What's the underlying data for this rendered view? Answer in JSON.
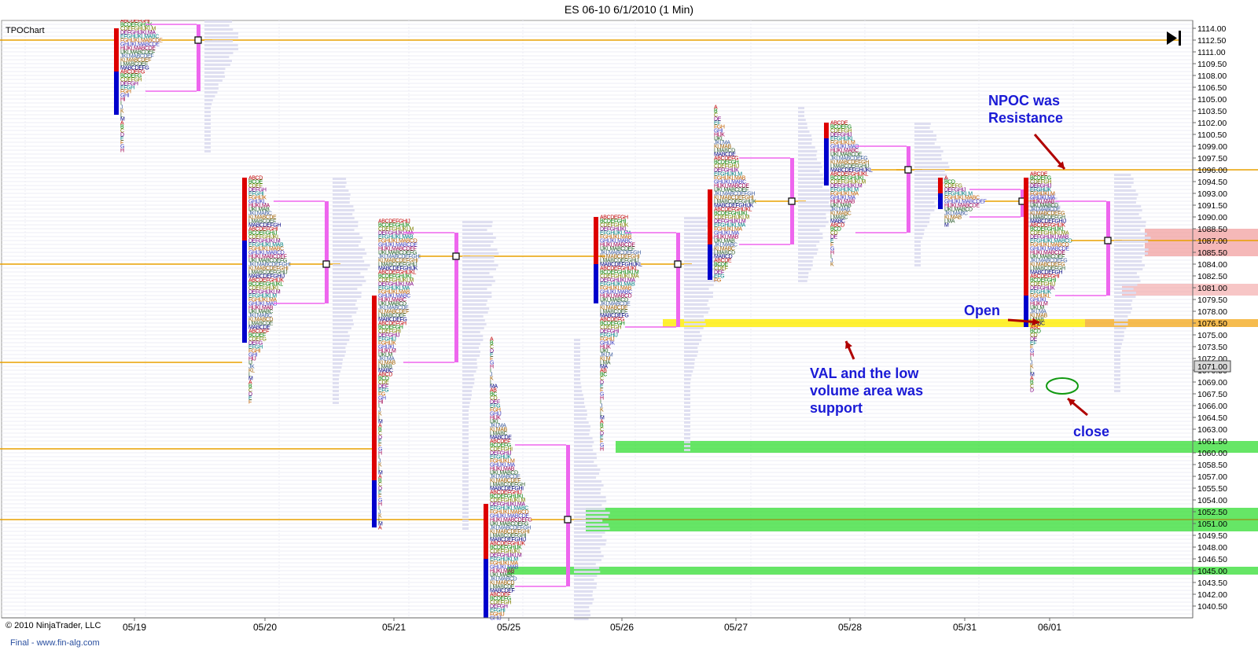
{
  "window": {
    "title": "ES 06-10  6/1/2010 (1 Min)",
    "chart_label": "TPOChart",
    "copyright": "© 2010 NinjaTrader, LLC",
    "watermark": "Final - www.fin-alg.com"
  },
  "colors": {
    "poc_line": "#e8a000",
    "value_area": "#ee66ee",
    "ib_red": "#dd0000",
    "ib_blue": "#0000cc",
    "profile_fill": "#dcdcf0",
    "annotation_text": "#1a1ad6",
    "annotation_arrow": "#b00000",
    "support_green": "#33dd33",
    "val_yellow": "#ffee00",
    "resistance_red": "#f2a0a0",
    "last_price_box": "#d8d8d8"
  },
  "chart_data": {
    "type": "market-profile",
    "title": "ES 06-10  6/1/2010 (1 Min)",
    "ylim": [
      1039.0,
      1115.0
    ],
    "y_ticks": [
      1114.0,
      1112.5,
      1111.0,
      1109.5,
      1108.0,
      1106.5,
      1105.0,
      1103.5,
      1102.0,
      1100.5,
      1099.0,
      1097.5,
      1096.0,
      1094.5,
      1093.0,
      1091.5,
      1090.0,
      1088.5,
      1087.0,
      1085.5,
      1084.0,
      1082.5,
      1081.0,
      1079.5,
      1078.0,
      1076.5,
      1075.0,
      1073.5,
      1072.0,
      1070.5,
      1069.0,
      1067.5,
      1066.0,
      1064.5,
      1063.0,
      1061.5,
      1060.0,
      1058.5,
      1057.0,
      1055.5,
      1054.0,
      1052.5,
      1051.0,
      1049.5,
      1048.0,
      1046.5,
      1045.0,
      1043.5,
      1042.0,
      1040.5
    ],
    "last_price": "1071.00",
    "sessions": [
      {
        "date": "05/19",
        "low": 1098.5,
        "high": 1115.0,
        "poc": 1112.5,
        "vah": 1114.5,
        "val": 1106.0,
        "ib_low": 1103.0,
        "ib_high": 1114.0,
        "ib_split": 1108.5
      },
      {
        "date": "05/20",
        "low": 1066.5,
        "high": 1095.0,
        "poc": 1084.0,
        "vah": 1092.0,
        "val": 1079.0,
        "ib_low": 1074.0,
        "ib_high": 1095.0,
        "ib_split": 1087.0
      },
      {
        "date": "05/21",
        "low": 1050.5,
        "high": 1089.5,
        "poc": 1085.0,
        "vah": 1088.0,
        "val": 1071.5,
        "ib_low": 1050.5,
        "ib_high": 1080.0,
        "ib_split": 1056.5
      },
      {
        "date": "05/25",
        "low": 1039.0,
        "high": 1074.5,
        "poc": 1051.5,
        "vah": 1061.0,
        "val": 1043.0,
        "ib_low": 1039.0,
        "ib_high": 1053.5,
        "ib_split": 1046.5
      },
      {
        "date": "05/26",
        "low": 1060.5,
        "high": 1090.0,
        "poc": 1084.0,
        "vah": 1088.0,
        "val": 1076.0,
        "ib_low": 1079.0,
        "ib_high": 1090.0,
        "ib_split": 1084.0
      },
      {
        "date": "05/27",
        "low": 1082.0,
        "high": 1104.0,
        "poc": 1092.0,
        "vah": 1097.5,
        "val": 1086.5,
        "ib_low": 1082.0,
        "ib_high": 1093.5,
        "ib_split": 1086.5
      },
      {
        "date": "05/28",
        "low": 1084.0,
        "high": 1102.0,
        "poc": 1096.0,
        "vah": 1099.0,
        "val": 1088.0,
        "ib_low": 1094.0,
        "ib_high": 1102.0,
        "ib_split": 1100.0
      },
      {
        "date": "05/31",
        "low": 1089.0,
        "high": 1095.0,
        "poc": 1092.0,
        "vah": 1093.5,
        "val": 1090.0,
        "ib_low": 1091.0,
        "ib_high": 1095.0,
        "ib_split": 1093.0
      },
      {
        "date": "06/01",
        "low": 1068.0,
        "high": 1095.5,
        "poc": 1087.0,
        "vah": 1092.0,
        "val": 1080.0,
        "ib_low": 1076.0,
        "ib_high": 1095.0,
        "ib_split": 1080.0
      }
    ],
    "naked_poc_lines": [
      1112.5,
      1084.0,
      1085.0,
      1096.0,
      1060.5,
      1051.5,
      1071.5
    ],
    "zones": [
      {
        "kind": "support",
        "low": 1060.0,
        "high": 1061.5
      },
      {
        "kind": "support",
        "low": 1050.0,
        "high": 1053.0
      },
      {
        "kind": "support",
        "low": 1044.5,
        "high": 1045.5
      },
      {
        "kind": "val",
        "low": 1076.0,
        "high": 1077.0
      },
      {
        "kind": "val-orange",
        "low": 1076.0,
        "high": 1077.0
      },
      {
        "kind": "resistance",
        "low": 1085.0,
        "high": 1088.5
      },
      {
        "kind": "resistance",
        "low": 1080.0,
        "high": 1081.5
      }
    ],
    "annotations": [
      {
        "text": [
          "NPOC was",
          "Resistance"
        ],
        "price": 1103.0
      },
      {
        "text": [
          "Open"
        ],
        "price": 1078.5
      },
      {
        "text": [
          "VAL and the low",
          "volume area was",
          "support"
        ],
        "price": 1070.0
      },
      {
        "text": [
          "close"
        ],
        "price": 1063.0
      }
    ]
  }
}
